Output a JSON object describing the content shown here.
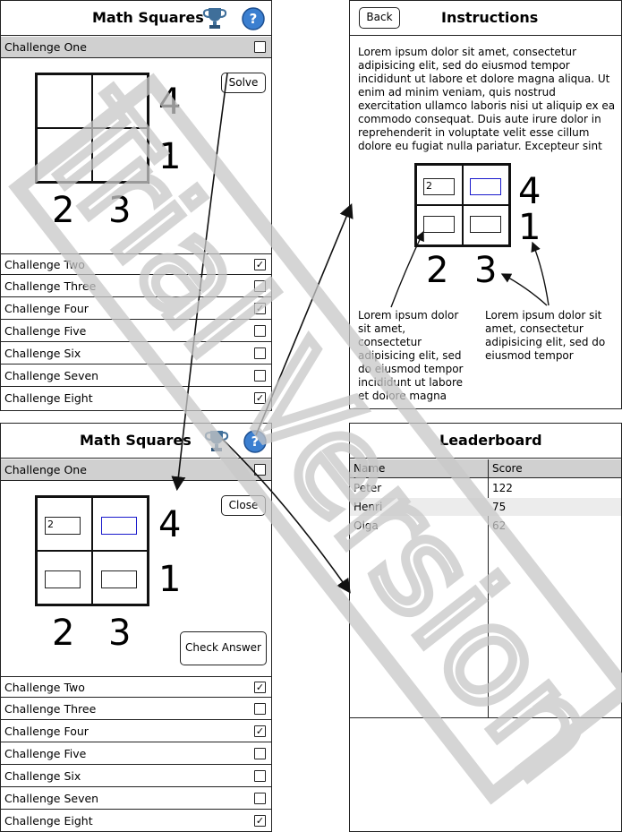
{
  "app": {
    "title": "Math Squares"
  },
  "challenges": [
    {
      "label": "Challenge One",
      "checked": false,
      "selected": true
    },
    {
      "label": "Challenge Two",
      "checked": true
    },
    {
      "label": "Challenge Three",
      "checked": false
    },
    {
      "label": "Challenge Four",
      "checked": true
    },
    {
      "label": "Challenge Five",
      "checked": false
    },
    {
      "label": "Challenge Six",
      "checked": false
    },
    {
      "label": "Challenge Seven",
      "checked": false
    },
    {
      "label": "Challenge Eight",
      "checked": true
    }
  ],
  "puzzle": {
    "row_sums": [
      "4",
      "1"
    ],
    "col_sums": [
      "2",
      "3"
    ],
    "entered_value": "2"
  },
  "buttons": {
    "solve": "Solve",
    "close": "Close",
    "check_answer": "Check Answer",
    "back": "Back"
  },
  "instructions": {
    "title": "Instructions",
    "body": "Lorem ipsum dolor sit amet, consectetur adipisicing elit, sed do eiusmod tempor incididunt ut labore et dolore magna aliqua. Ut enim ad minim veniam, quis nostrud exercitation ullamco laboris nisi ut aliquip ex ea commodo consequat. Duis aute irure dolor in reprehenderit in voluptate velit esse cillum dolore eu fugiat nulla pariatur. Excepteur sint",
    "note_left": "Lorem ipsum dolor sit amet, consectetur adipisicing elit, sed do eiusmod tempor incididunt ut labore et dolore magna",
    "note_right": "Lorem ipsum dolor sit amet, consectetur adipisicing elit, sed do eiusmod tempor"
  },
  "leaderboard": {
    "title": "Leaderboard",
    "columns": [
      "Name",
      "Score"
    ],
    "rows": [
      {
        "name": "Peter",
        "score": "122"
      },
      {
        "name": "Henri",
        "score": "75"
      },
      {
        "name": "Olga",
        "score": "62"
      }
    ]
  },
  "watermark": "Trial Version",
  "colors": {
    "selected_row": "#d0d0d0",
    "active_input": "#1a1acc",
    "watermark": "#c8c8c8"
  }
}
